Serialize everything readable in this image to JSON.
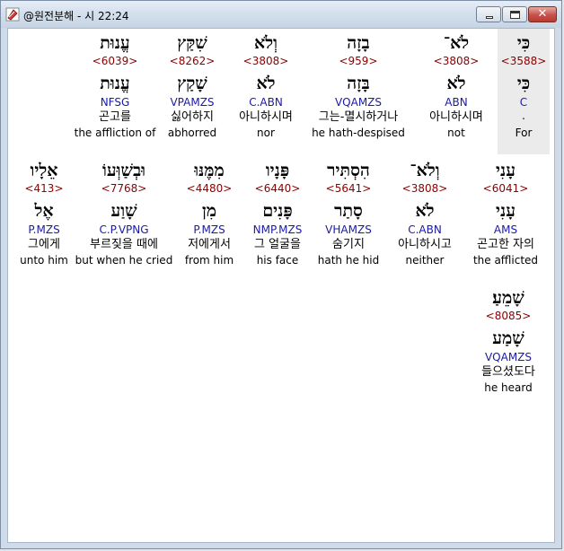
{
  "window": {
    "title": "@원전분해 - 시 22:24",
    "minimize_label": "",
    "maximize_label": "",
    "close_label": "✕"
  },
  "words": [
    {
      "id": "w1",
      "hebrew": "כִּי",
      "strong": "<3588>",
      "lemma": "כִּי",
      "parse": "C",
      "parse2": ".",
      "korean": "",
      "english": "For",
      "highlight": true
    },
    {
      "id": "w2",
      "hebrew": "לֹא־",
      "strong": "<3808>",
      "lemma": "לֹא",
      "parse": "ABN",
      "korean": "아니하시며",
      "english": "not"
    },
    {
      "id": "w3",
      "hebrew": "בָזָה",
      "strong": "<959>",
      "lemma": "בָּזָה",
      "parse": "VQAMZS",
      "korean": "그는-멸시하거나",
      "english": "he hath-despised"
    },
    {
      "id": "w4",
      "hebrew": "וְלֹא",
      "strong": "<3808>",
      "lemma": "לֹא",
      "parse": "C.ABN",
      "korean": "아니하시며",
      "english": "nor"
    },
    {
      "id": "w5",
      "hebrew": "שִׁקַּץ",
      "strong": "<8262>",
      "lemma": "שָׁקַץ",
      "parse": "VPAMZS",
      "korean": "싫어하지",
      "english": "abhorred"
    },
    {
      "id": "w6",
      "hebrew": "עֱנוּת",
      "strong": "<6039>",
      "lemma": "עֱנוּת",
      "parse": "NFSG",
      "korean": "곤고를",
      "english": "the affliction of"
    },
    {
      "id": "w7",
      "hebrew": "עָנִי",
      "strong": "<6041>",
      "lemma": "עָנִי",
      "parse": "AMS",
      "korean": "곤고한 자의",
      "english": "the afflicted"
    },
    {
      "id": "w8",
      "hebrew": "וְלֹא־",
      "strong": "<3808>",
      "lemma": "לֹא",
      "parse": "C.ABN",
      "korean": "아니하시고",
      "english": "neither"
    },
    {
      "id": "w9",
      "hebrew": "הִסְתִּיר",
      "strong": "<5641>",
      "lemma": "סָתַר",
      "parse": "VHAMZS",
      "korean": "숨기지",
      "english": "hath he hid"
    },
    {
      "id": "w10",
      "hebrew": "פָּנָיו",
      "strong": "<6440>",
      "lemma": "פָּנִים",
      "parse": "NMP.MZS",
      "korean": "그 얼굴을",
      "english": "his face"
    },
    {
      "id": "w11",
      "hebrew": "מִמֶּנּוּ",
      "strong": "<4480>",
      "lemma": "מִן",
      "parse": "P.MZS",
      "korean": "저에게서",
      "english": "from him"
    },
    {
      "id": "w12",
      "hebrew": "וּבְשַׁוְּעוֹ",
      "strong": "<7768>",
      "lemma": "שָׁוַע",
      "parse": "C.P.VPNG",
      "korean": "부르짖을 때에",
      "english": "but when he cried"
    },
    {
      "id": "w13",
      "hebrew": "אֵלָיו",
      "strong": "<413>",
      "lemma": "אֶל",
      "parse": "P.MZS",
      "korean": "그에게",
      "english": "unto him"
    },
    {
      "id": "w14",
      "hebrew": "שָׁמֵעַ׃",
      "strong": "<8085>",
      "lemma": "שָׁמַע",
      "parse": "VQAMZS",
      "korean": "들으셨도다",
      "english": "he heard"
    }
  ]
}
